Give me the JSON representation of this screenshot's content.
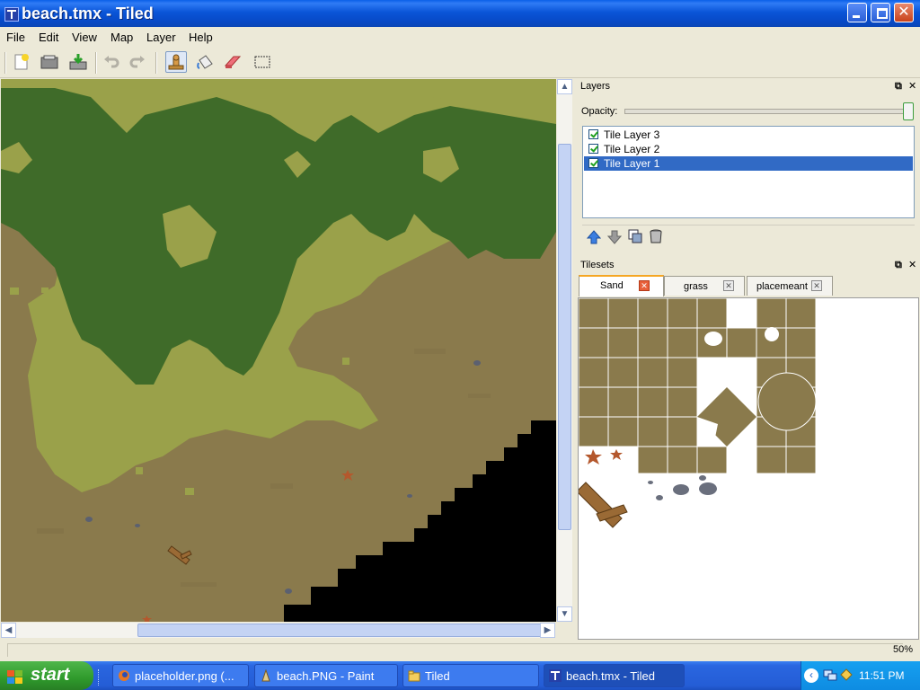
{
  "window": {
    "title": "beach.tmx - Tiled",
    "close_glyph": "✕"
  },
  "menu": [
    "File",
    "Edit",
    "View",
    "Map",
    "Layer",
    "Help"
  ],
  "toolbar": {
    "buttons": [
      "new-map-icon",
      "open-icon",
      "save-icon",
      "undo-icon",
      "redo-icon",
      "stamp-brush-icon",
      "bucket-fill-icon",
      "eraser-icon",
      "rect-select-icon"
    ],
    "active": "stamp-brush-icon"
  },
  "layers_panel": {
    "title": "Layers",
    "opacity_label": "Opacity:",
    "opacity_value": 1.0,
    "layers": [
      {
        "name": "Tile Layer 3",
        "visible": true,
        "selected": false
      },
      {
        "name": "Tile Layer 2",
        "visible": true,
        "selected": false
      },
      {
        "name": "Tile Layer 1",
        "visible": true,
        "selected": true
      }
    ],
    "actions": [
      "move-layer-up-icon",
      "move-layer-down-icon",
      "duplicate-layer-icon",
      "delete-layer-icon"
    ]
  },
  "tilesets_panel": {
    "title": "Tilesets",
    "tabs": [
      {
        "label": "Sand",
        "active": true
      },
      {
        "label": "grass",
        "active": false
      },
      {
        "label": "placemeant",
        "active": false
      }
    ]
  },
  "status": {
    "zoom": "50%"
  },
  "scroll_glyphs": {
    "up": "▲",
    "down": "▼",
    "left": "◀",
    "right": "▶"
  },
  "taskbar": {
    "start_label": "start",
    "tasks": [
      {
        "label": "placeholder.png (...",
        "icon": "firefox-icon"
      },
      {
        "label": "beach.PNG - Paint",
        "icon": "paint-icon"
      },
      {
        "label": "Tiled",
        "icon": "folder-icon"
      },
      {
        "label": "beach.tmx - Tiled",
        "icon": "tiled-icon",
        "active": true
      }
    ],
    "clock": "11:51 PM"
  },
  "colors": {
    "grass_dark": "#3f6b29",
    "grass_light": "#9aa14a",
    "sand": "#8a7a4c",
    "selection": "#316ac5"
  }
}
